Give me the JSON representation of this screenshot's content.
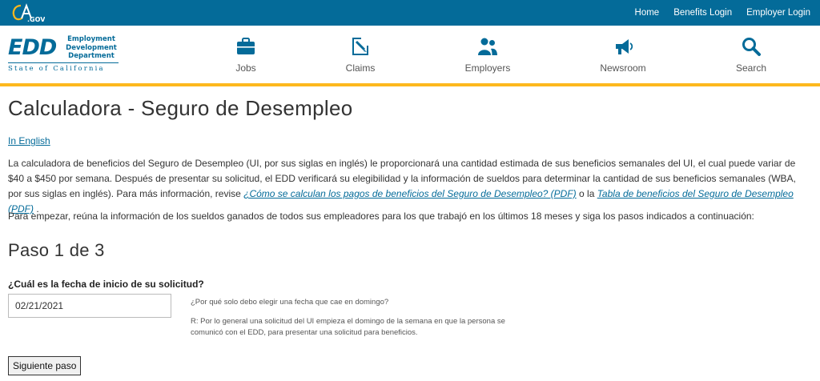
{
  "topbar": {
    "logo_icon": "ca-gov-logo",
    "links": [
      "Home",
      "Benefits Login",
      "Employer Login"
    ],
    "background": "#046b99"
  },
  "header": {
    "logo": {
      "short": "EDD",
      "dept_line1": "Employment",
      "dept_line2": "Development",
      "dept_line3": "Department",
      "state": "State of California"
    },
    "nav": [
      {
        "label": "Jobs",
        "icon": "briefcase-icon"
      },
      {
        "label": "Claims",
        "icon": "claims-pen-icon"
      },
      {
        "label": "Employers",
        "icon": "people-icon"
      },
      {
        "label": "Newsroom",
        "icon": "megaphone-icon"
      },
      {
        "label": "Search",
        "icon": "search-icon"
      }
    ],
    "accent_rule": "#fdb81e"
  },
  "main": {
    "title": "Calculadora - Seguro de Desempleo",
    "lang_link": "In English",
    "intro_text": "La calculadora de beneficios del Seguro de Desempleo (UI, por sus siglas en inglés) le proporcionará una cantidad estimada de sus beneficios semanales  del UI, el cual puede variar de $40 a $450 por semana. Después de presentar su solicitud, el EDD verificará su elegibilidad y la información de sueldos para determinar la cantidad de sus beneficios semanales (WBA, por sus siglas en inglés). Para más información, revise ",
    "intro_link1": "¿Cómo se calculan los pagos de beneficios del Seguro de Desempleo? (PDF)",
    "intro_join": " o la ",
    "intro_link2": "Tabla de beneficios del Seguro de Desempleo (PDF)",
    "intro_end": " .",
    "intro2_text": "Para empezar, reúna la información de los sueldos ganados de todos sus empleadores para los que trabajó en los últimos 18 meses y siga los pasos indicados a continuación:",
    "step_title": "Paso 1 de 3",
    "question_label": "¿Cuál es la fecha de inicio de su solicitud?",
    "date_value": "02/21/2021",
    "help_question": "¿Por qué solo debo elegir una fecha que cae en domingo?",
    "help_answer": "R: Por lo general una solicitud del UI empieza el domingo de la semana en que la persona se comunicó con el EDD, para presentar una solicitud para beneficios.",
    "next_button": "Siguiente paso",
    "link_color": "#046b99"
  }
}
